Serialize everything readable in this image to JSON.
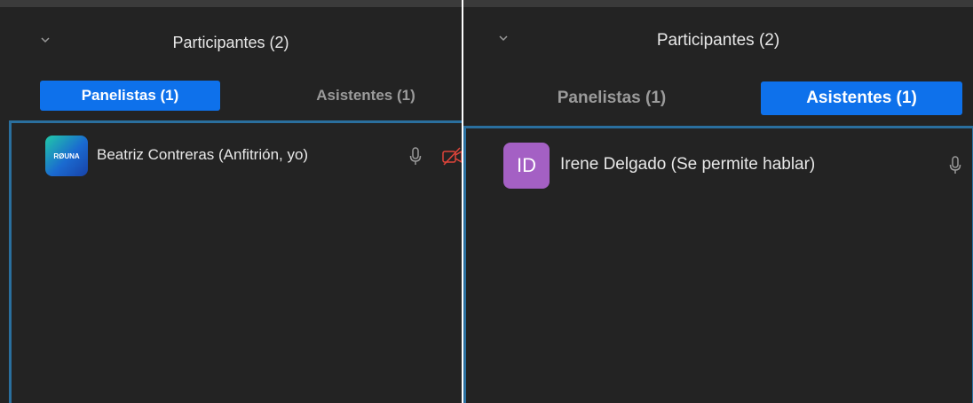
{
  "panels": [
    {
      "title": "Participantes (2)",
      "tabs": [
        {
          "label": "Panelistas (1)",
          "active": true
        },
        {
          "label": "Asistentes (1)",
          "active": false
        }
      ],
      "participants": [
        {
          "name": "Beatriz Contreras (Anfitrión, yo)",
          "avatar_text": "RØUNA",
          "avatar_type": "logo",
          "icons": [
            "microphone-icon",
            "video-off-icon"
          ]
        }
      ]
    },
    {
      "title": "Participantes (2)",
      "tabs": [
        {
          "label": "Panelistas (1)",
          "active": false
        },
        {
          "label": "Asistentes (1)",
          "active": true
        }
      ],
      "participants": [
        {
          "name": "Irene Delgado (Se permite hablar)",
          "avatar_text": "ID",
          "avatar_type": "initials",
          "icons": [
            "microphone-icon"
          ]
        }
      ]
    }
  ],
  "colors": {
    "background": "#232323",
    "accent": "#0e71eb",
    "selection_border": "#2a6f9e",
    "video_off": "#e0443a",
    "avatar_purple": "#a460c4"
  }
}
